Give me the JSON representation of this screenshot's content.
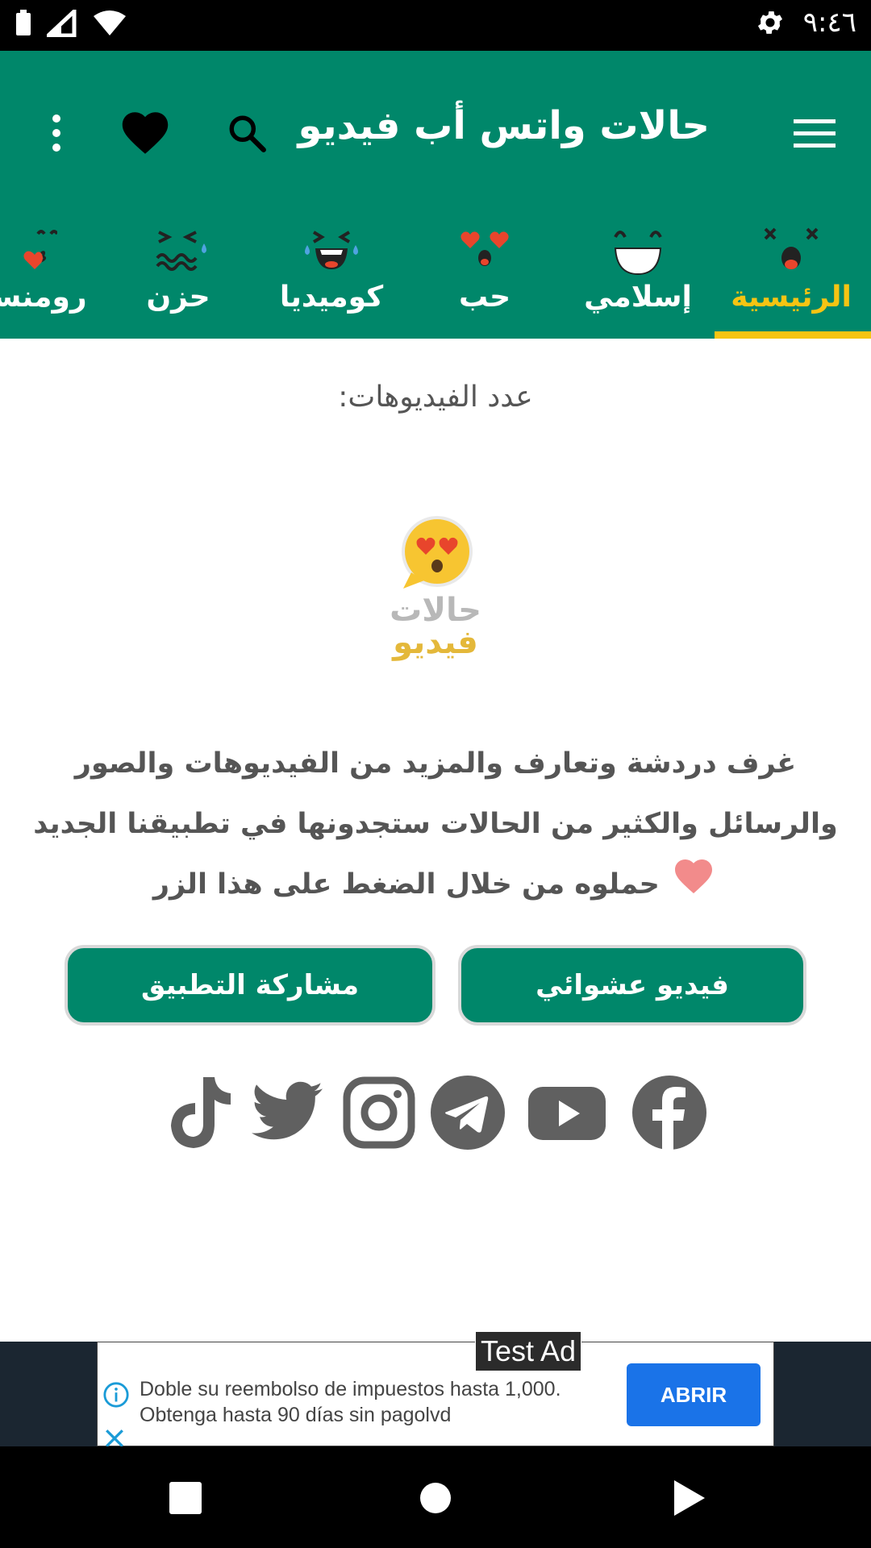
{
  "status_bar": {
    "time": "٩:٤٦",
    "icons": [
      "battery-icon",
      "signal-icon",
      "wifi-icon",
      "settings-icon"
    ]
  },
  "app_bar": {
    "title": "حالات واتس أب فيديو",
    "icons": [
      "menu-icon",
      "search-icon",
      "heart-icon",
      "more-vert-icon"
    ],
    "color": "#00876a"
  },
  "tabs": [
    {
      "label": "الرئيسية",
      "active": true
    },
    {
      "label": "إسلامي",
      "active": false
    },
    {
      "label": "حب",
      "active": false
    },
    {
      "label": "كوميديا",
      "active": false
    },
    {
      "label": "حزن",
      "active": false
    },
    {
      "label": "رومنسي",
      "active": false
    }
  ],
  "tab_indicator_color": "#f6c413",
  "content": {
    "video_count_label": "عدد الفيديوهات:",
    "logo": {
      "line1": "حالات",
      "line2": "فيديو"
    },
    "description_part1": "غرف دردشة وتعارف والمزيد من الفيديوهات والصور والرسائل والكثير من الحالات ستجدونها في تطبيقنا الجديد",
    "description_part2": "حملوه من خلال الضغط على هذا الزر",
    "random_video_button": "فيديو عشوائي",
    "share_app_button": "مشاركة التطبيق",
    "socials": [
      "tiktok-icon",
      "twitter-icon",
      "instagram-icon",
      "telegram-icon",
      "youtube-icon",
      "facebook-icon"
    ]
  },
  "ad": {
    "tag": "Test Ad",
    "text": "Doble su reembolso de impuestos hasta 1,000. Obtenga hasta 90 días sin pagolvd",
    "button": "ABRIR"
  },
  "nav_bar": {
    "buttons": [
      "recents-button",
      "home-button",
      "back-button"
    ]
  }
}
